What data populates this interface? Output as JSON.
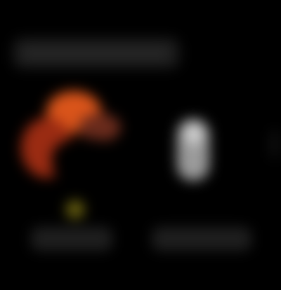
{
  "header": {
    "title": ""
  },
  "tiles": [
    {
      "label": "",
      "icon": "album-art-icon",
      "badge_color": "#6b6210",
      "accent_colors": [
        "#d9541a",
        "#9a2b12"
      ]
    },
    {
      "label": "",
      "icon": "person-figure-icon"
    }
  ],
  "theme": {
    "background": "#000000",
    "surface": "#1e1e1e"
  }
}
